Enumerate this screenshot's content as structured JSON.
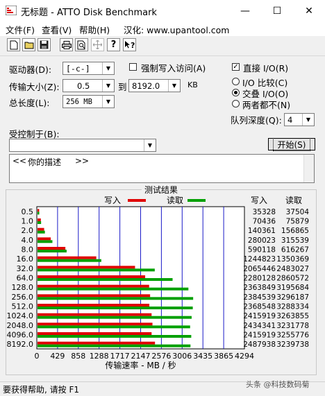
{
  "window": {
    "title": "无标题 - ATTO Disk Benchmark",
    "controls": [
      "—",
      "☐",
      "✕"
    ]
  },
  "menu": {
    "file": "文件(F)",
    "view": "查看(V)",
    "help": "帮助(H)",
    "credit": "汉化: www.upantool.com"
  },
  "toolbar": {
    "icons": [
      "new-file-icon",
      "open-folder-icon",
      "save-icon",
      "print-icon",
      "print-preview-icon",
      "move-icon",
      "help-icon",
      "context-help-icon"
    ]
  },
  "settings": {
    "drive_label": "驱动器(D):",
    "drive_value": "[-c-]",
    "force_write_label": "强制写入访问(A)",
    "transfer_label": "传输大小(Z):",
    "transfer_from": "0.5",
    "to_label": "到",
    "transfer_to": "8192.0",
    "kb_label": "KB",
    "total_label": "总长度(L):",
    "total_value": "256 MB",
    "direct_io_label": "直接 I/O(R)",
    "direct_io_checked": true,
    "io_compare_label": "I/O 比较(C)",
    "overlap_io_label": "交叠 I/O(O)",
    "neither_label": "两者都不(N)",
    "selected_radio": "overlap",
    "queue_label": "队列深度(Q):",
    "queue_value": "4",
    "controlled_by_label": "受控制于(B):",
    "controlled_by_value": "",
    "start_button": "开始(S)",
    "desc_left": "<<",
    "desc_text": "你的描述",
    "desc_right": ">>"
  },
  "status_text": "要获得帮助, 请按 F1",
  "watermark": "头条 @科技数码菊",
  "chart_data": {
    "type": "bar",
    "title": "测试结果",
    "xlabel": "传输速率 - MB / 秒",
    "xlim": [
      0,
      4294
    ],
    "xticks": [
      "0",
      "429",
      "858",
      "1288",
      "1717",
      "2147",
      "2576",
      "3006",
      "3435",
      "3865",
      "4294"
    ],
    "write_header": "写入",
    "read_header": "读取",
    "categories": [
      "0.5",
      "1.0",
      "2.0",
      "4.0",
      "8.0",
      "16.0",
      "32.0",
      "64.0",
      "128.0",
      "256.0",
      "512.0",
      "1024.0",
      "2048.0",
      "4096.0",
      "8192.0"
    ],
    "series": [
      {
        "name": "写入",
        "color": "#e00000",
        "values": [
          35328,
          70436,
          140361,
          280023,
          590118,
          1244823,
          2065446,
          2280128,
          2363849,
          2384539,
          2368548,
          2415919,
          2434341,
          2415919,
          2487938
        ]
      },
      {
        "name": "读取",
        "color": "#00a000",
        "values": [
          37504,
          75879,
          156865,
          315539,
          616267,
          1350369,
          2483027,
          2860572,
          3195684,
          3296187,
          3288334,
          3263855,
          3231778,
          3255776,
          3239738
        ]
      }
    ]
  }
}
